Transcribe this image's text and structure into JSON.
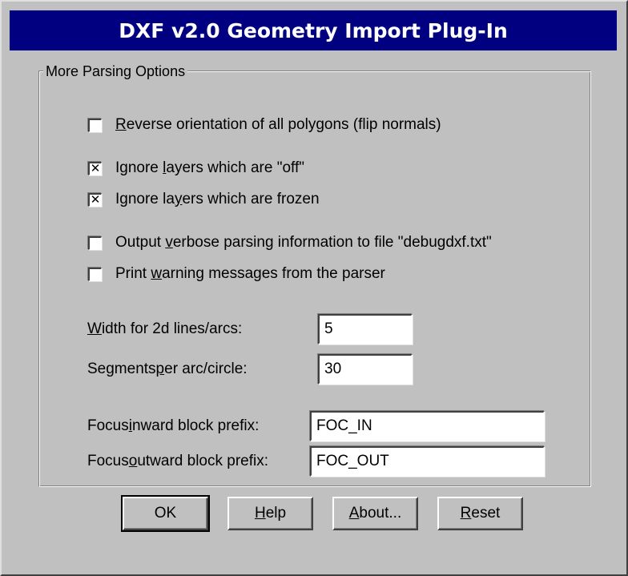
{
  "window": {
    "title": "DXF v2.0 Geometry Import Plug-In"
  },
  "group": {
    "legend": "More Parsing Options"
  },
  "options": [
    {
      "label_pre": "",
      "mnemonic": "R",
      "label_post": "everse orientation of all polygons (flip normals)",
      "checked": false
    },
    {
      "label_pre": "Ignore ",
      "mnemonic": "l",
      "label_post": "ayers which are \"off\"",
      "checked": true
    },
    {
      "label_pre": "Ignore la",
      "mnemonic": "y",
      "label_post": "ers which are frozen",
      "checked": true
    },
    {
      "label_pre": "Output ",
      "mnemonic": "v",
      "label_post": "erbose parsing information to file \"debugdxf.txt\"",
      "checked": false
    },
    {
      "label_pre": "Print ",
      "mnemonic": "w",
      "label_post": "arning messages from the parser",
      "checked": false
    }
  ],
  "fields": {
    "width": {
      "label_pre": "",
      "mnemonic": "W",
      "label_post": "idth for 2d lines/arcs:",
      "value": "5"
    },
    "segments": {
      "label_pre": "Segments ",
      "mnemonic": "p",
      "label_post": "er arc/circle:",
      "value": "30"
    },
    "focus_in": {
      "label_pre": "Focus ",
      "mnemonic": "i",
      "label_post": "nward block prefix:",
      "value": "FOC_IN"
    },
    "focus_out": {
      "label_pre": "Focus ",
      "mnemonic": "o",
      "label_post": "utward block prefix:",
      "value": "FOC_OUT"
    }
  },
  "buttons": {
    "ok": {
      "label_pre": "OK",
      "mnemonic": "",
      "label_post": ""
    },
    "help": {
      "label_pre": "",
      "mnemonic": "H",
      "label_post": "elp"
    },
    "about": {
      "label_pre": "",
      "mnemonic": "A",
      "label_post": "bout..."
    },
    "reset": {
      "label_pre": "",
      "mnemonic": "R",
      "label_post": "eset"
    }
  },
  "colors": {
    "title_bar": "#000080",
    "face": "#c0c0c0"
  }
}
